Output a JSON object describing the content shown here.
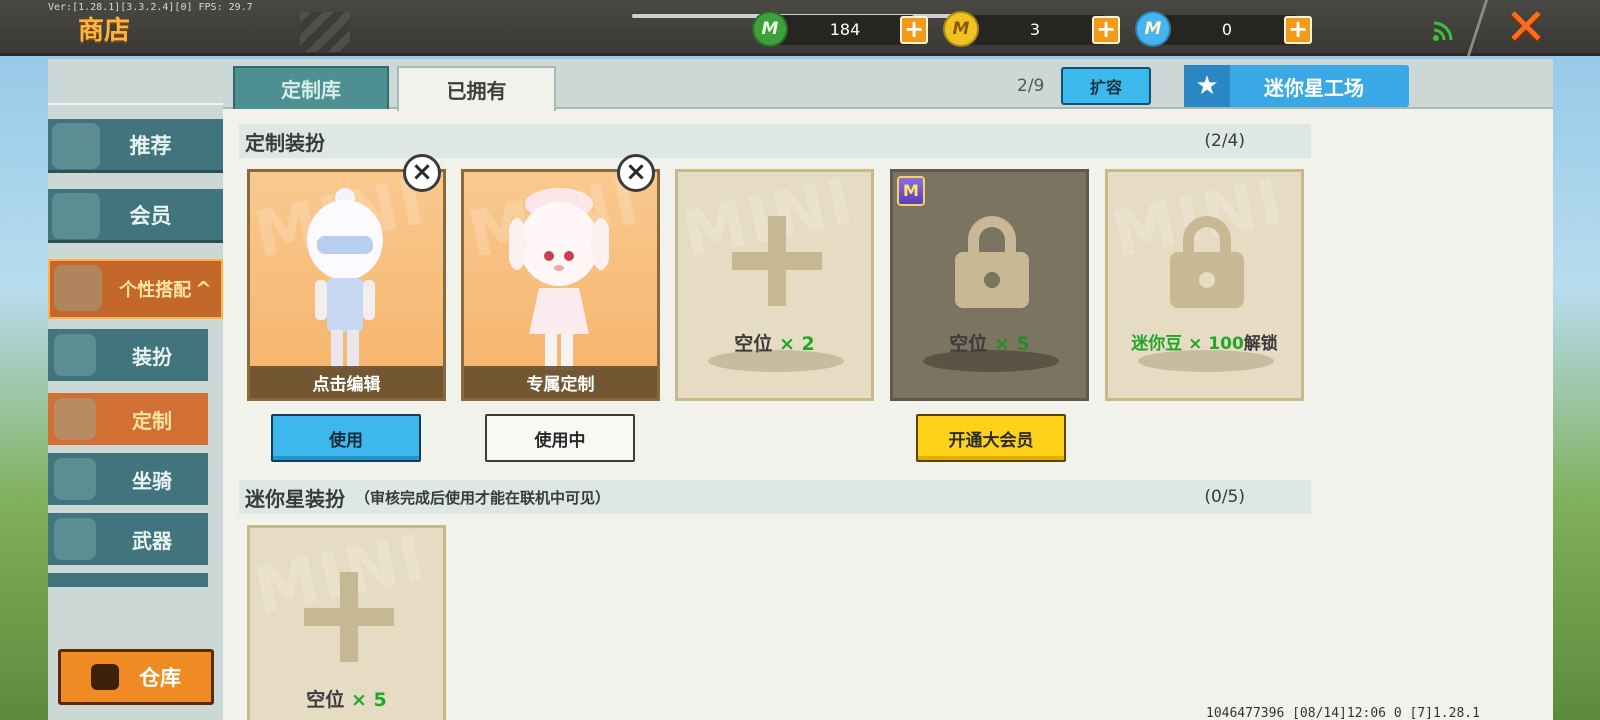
{
  "topbar": {
    "version": "Ver:[1.28.1][3.3.2.4][0] FPS: 29.7",
    "title": "商店",
    "currencies": [
      {
        "icon": "mini-coin-green-icon",
        "symbol": "M",
        "value": "184",
        "color": "#3da03a"
      },
      {
        "icon": "mini-coin-gold-icon",
        "symbol": "M",
        "value": "3",
        "color": "#f2c320"
      },
      {
        "icon": "mini-coin-blue-icon",
        "symbol": "M",
        "value": "0",
        "color": "#46b4f0"
      }
    ],
    "plus_label": "+",
    "close_label": "✕"
  },
  "sidebar": {
    "items": [
      {
        "label": "推荐",
        "icon": "thumbs-up-icon"
      },
      {
        "label": "会员",
        "icon": "member-card-icon"
      },
      {
        "label": "个性搭配",
        "icon": "trophy-icon",
        "expand": "^"
      }
    ],
    "subitems": [
      {
        "label": "装扮",
        "icon": "shirt-icon"
      },
      {
        "label": "定制",
        "icon": "pencil-icon"
      },
      {
        "label": "坐骑",
        "icon": "mount-icon"
      },
      {
        "label": "武器",
        "icon": "gun-icon"
      }
    ],
    "warehouse_label": "仓库"
  },
  "tabs": {
    "library": "定制库",
    "owned": "已拥有"
  },
  "capacity": {
    "text": "2/9",
    "expand_label": "扩容"
  },
  "workshop_label": "迷你星工场",
  "custom_section": {
    "title": "定制装扮",
    "count": "(2/4)",
    "cards": [
      {
        "caption": "点击编辑",
        "action": "使用"
      },
      {
        "caption": "专属定制",
        "action": "使用中"
      },
      {
        "slot_label": "空位",
        "slot_count": "× 2"
      },
      {
        "slot_label": "空位",
        "slot_count": "× 5",
        "vip_badge": "M",
        "action": "开通大会员"
      },
      {
        "unlock_currency": "迷你豆 × 100",
        "unlock_suffix": "解锁"
      }
    ]
  },
  "star_section": {
    "title": "迷你星装扮",
    "note": "（审核完成后使用才能在联机中可见）",
    "count": "(0/5)",
    "cards": [
      {
        "slot_label": "空位",
        "slot_count": "× 5"
      }
    ]
  },
  "footer": "1046477396  [08/14]12:06 0  [7]1.28.1",
  "colors": {
    "accent_orange": "#f08a23",
    "accent_blue": "#3eb7ee",
    "vip_yellow": "#ffd21a",
    "slot_green": "#22a62a"
  }
}
